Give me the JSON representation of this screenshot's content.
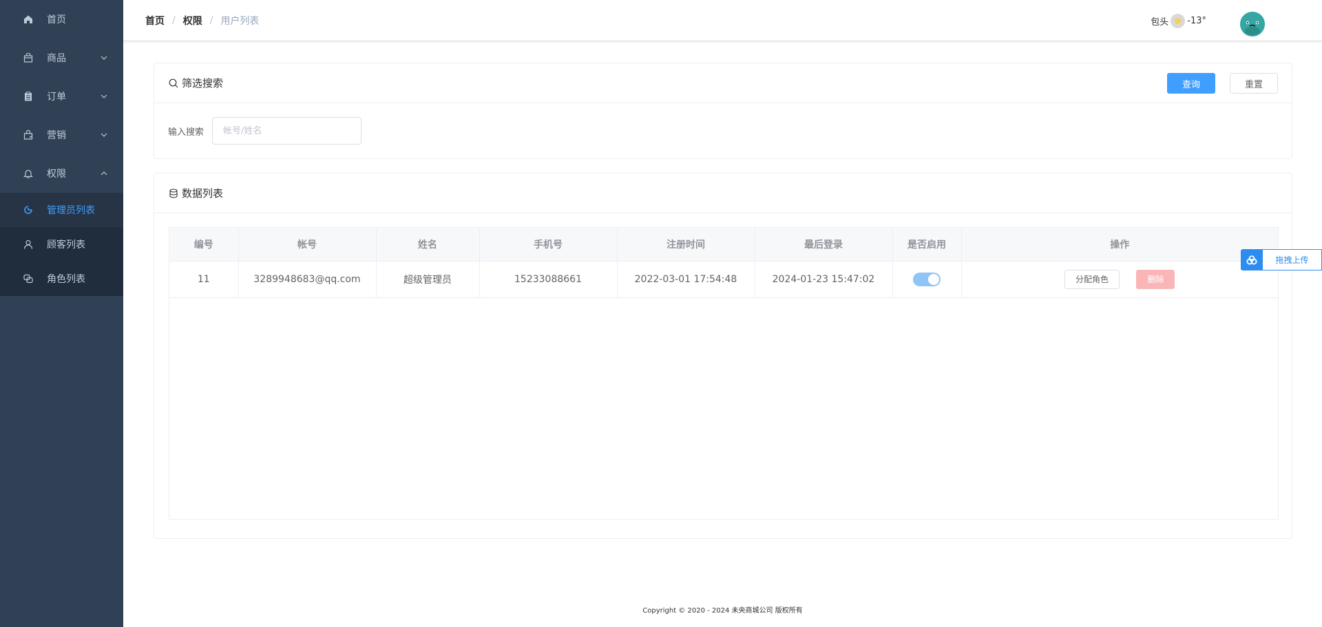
{
  "sidebar": {
    "items": [
      {
        "label": "首页",
        "icon": "home-icon"
      },
      {
        "label": "商品",
        "icon": "bag-icon"
      },
      {
        "label": "订单",
        "icon": "clipboard-icon"
      },
      {
        "label": "营销",
        "icon": "gift-icon"
      },
      {
        "label": "权限",
        "icon": "bell-icon"
      }
    ],
    "submenu": [
      {
        "label": "管理员列表",
        "icon": "chart-icon",
        "active": true
      },
      {
        "label": "顾客列表",
        "icon": "user-icon"
      },
      {
        "label": "角色列表",
        "icon": "role-icon"
      }
    ]
  },
  "header": {
    "breadcrumb": [
      "首页",
      "权限",
      "用户列表"
    ],
    "weather": {
      "city": "包头",
      "temp": "-13°"
    }
  },
  "filter": {
    "title": "筛选搜索",
    "query_button": "查询",
    "reset_button": "重置",
    "label": "输入搜索",
    "placeholder": "帐号/姓名"
  },
  "data_list": {
    "title": "数据列表",
    "columns": [
      "编号",
      "帐号",
      "姓名",
      "手机号",
      "注册时间",
      "最后登录",
      "是否启用",
      "操作"
    ],
    "rows": [
      {
        "id": "11",
        "account": "3289948683@qq.com",
        "name": "超级管理员",
        "phone": "15233088661",
        "registered": "2022-03-01 17:54:48",
        "last_login": "2024-01-23 15:47:02",
        "enabled": true,
        "assign_role": "分配角色",
        "delete": "删除"
      }
    ]
  },
  "upload_float": "拖拽上传",
  "footer": "Copyright © 2020 - 2024 未央商城公司 版权所有",
  "colors": {
    "sidebar_bg": "#304156",
    "primary": "#409eff",
    "submenu_bg": "#1f2d3d",
    "danger_disabled": "#fab6b6"
  }
}
